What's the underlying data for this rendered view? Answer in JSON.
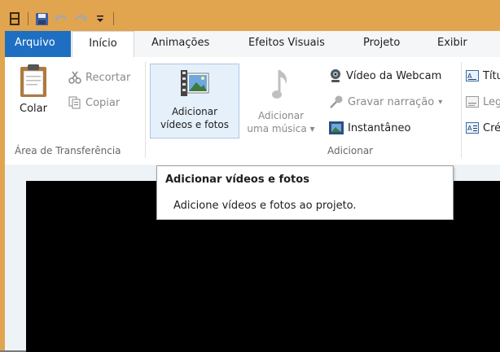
{
  "tabs": {
    "file": "Arquivo",
    "home": "Início",
    "animations": "Animações",
    "visual_effects": "Efeitos Visuais",
    "project": "Projeto",
    "view": "Exibir"
  },
  "clipboard": {
    "paste": "Colar",
    "cut": "Recortar",
    "copy": "Copiar",
    "group_label": "Área de Transferência"
  },
  "add": {
    "add_videos_line1": "Adicionar",
    "add_videos_line2": "vídeos e fotos",
    "add_music_line1": "Adicionar",
    "add_music_line2": "uma música",
    "webcam": "Vídeo da Webcam",
    "narration": "Gravar narração",
    "snapshot": "Instantâneo",
    "group_label": "Adicionar"
  },
  "text_group": {
    "title": "Títu",
    "caption": "Leg",
    "credits": "Cré"
  },
  "tooltip": {
    "title": "Adicionar vídeos e fotos",
    "description": "Adicione vídeos e fotos ao projeto."
  },
  "colors": {
    "titlebar": "#e1a44f",
    "file_tab": "#1e6fc2",
    "accent": "#1e6fc2"
  }
}
